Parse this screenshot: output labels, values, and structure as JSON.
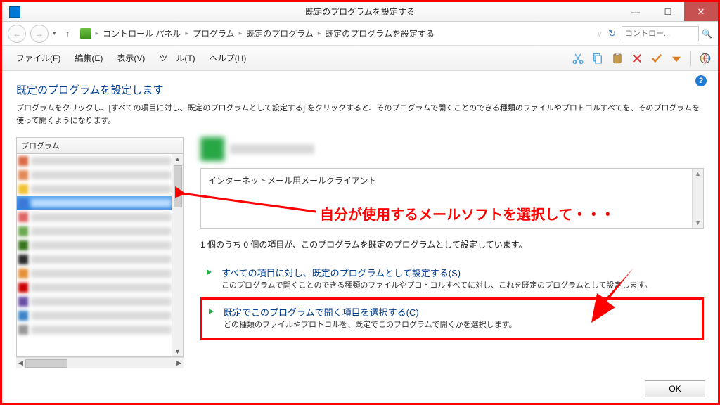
{
  "window": {
    "title": "既定のプログラムを設定する",
    "min_tip": "最小化",
    "max_tip": "最大化",
    "close_tip": "閉じる"
  },
  "breadcrumbs": {
    "items": [
      "コントロール パネル",
      "プログラム",
      "既定のプログラム",
      "既定のプログラムを設定する"
    ]
  },
  "search": {
    "placeholder": "コントロー...",
    "refresh_tip": "更新"
  },
  "menus": {
    "file": "ファイル(F)",
    "edit": "編集(E)",
    "view": "表示(V)",
    "tools": "ツール(T)",
    "help": "ヘルプ(H)"
  },
  "toolbar": {
    "cut_tip": "切り取り",
    "copy_tip": "コピー",
    "paste_tip": "貼り付け",
    "delete_tip": "削除",
    "ok_tip": "OK",
    "down_tip": "下",
    "globe_tip": "ヘルプ"
  },
  "page": {
    "heading": "既定のプログラムを設定します",
    "desc": "プログラムをクリックし、[すべての項目に対し、既定のプログラムとして設定する] をクリックすると、そのプログラムで開くことのできる種類のファイルやプロトコルすべてを、そのプログラムを使って開くようになります。",
    "programs_caption": "プログラム",
    "detail_desc": "インターネットメール用メールクライアント",
    "status": "1 個のうち 0 個の項目が、このプログラムを既定のプログラムとして設定しています。",
    "opt1_title": "すべての項目に対し、既定のプログラムとして設定する(S)",
    "opt1_desc": "このプログラムで開くことのできる種類のファイルやプロトコルすべてに対し、これを既定のプログラムとして設定します。",
    "opt2_title": "既定でこのプログラムで開く項目を選択する(C)",
    "opt2_desc": "どの種類のファイルやプロトコルを、既定でこのプログラムで開くかを選択します。",
    "ok": "OK",
    "help_tip": "ヘルプ"
  },
  "program_rows": [
    {
      "color": "#da6d46",
      "selected": false
    },
    {
      "color": "#e28a57",
      "selected": false
    },
    {
      "color": "#f1c232",
      "selected": false
    },
    {
      "color": "#3c78d8",
      "selected": true
    },
    {
      "color": "#e06666",
      "selected": false
    },
    {
      "color": "#6aa84f",
      "selected": false
    },
    {
      "color": "#38761d",
      "selected": false
    },
    {
      "color": "#2c2c2c",
      "selected": false
    },
    {
      "color": "#e69138",
      "selected": false
    },
    {
      "color": "#cc0000",
      "selected": false
    },
    {
      "color": "#674ea7",
      "selected": false
    },
    {
      "color": "#3d85c6",
      "selected": false
    },
    {
      "color": "#999999",
      "selected": false
    }
  ],
  "annotation": {
    "text": "自分が使用するメールソフトを選択して・・・"
  }
}
